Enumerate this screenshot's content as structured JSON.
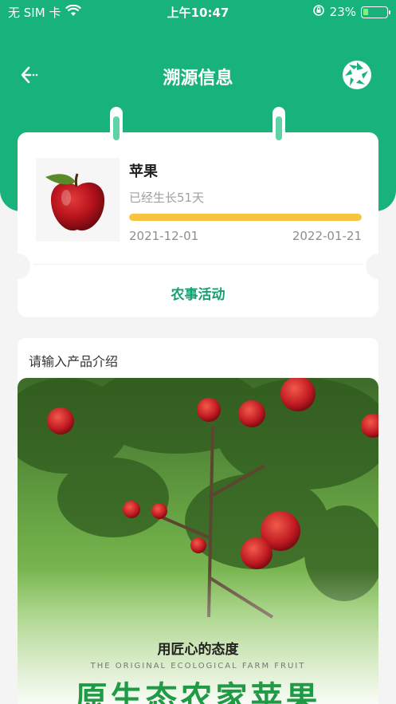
{
  "status_bar": {
    "carrier": "无 SIM 卡",
    "time": "上午10:47",
    "battery": "23%",
    "battery_level": 0.23
  },
  "nav": {
    "title": "溯源信息",
    "back_icon": "back-arrow-icon",
    "scan_icon": "aperture-icon"
  },
  "product": {
    "name": "苹果",
    "growth_text": "已经生长51天",
    "progress": 1.0,
    "start_date": "2021-12-01",
    "end_date": "2022-01-21",
    "activity_label": "农事活动"
  },
  "intro": {
    "label": "请输入产品介绍",
    "slogan": "用匠心的态度",
    "slogan_en": "THE ORIGINAL ECOLOGICAL FARM FRUIT",
    "big_title": "原生态农家苹果"
  },
  "colors": {
    "brand_green": "#17b37a",
    "progress_yellow": "#f7c340",
    "activity_green": "#17a06e"
  }
}
